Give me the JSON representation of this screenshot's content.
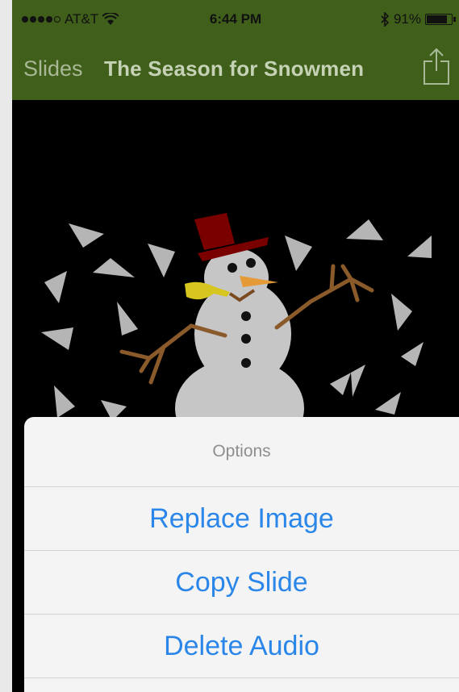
{
  "status": {
    "carrier": "AT&T",
    "time": "6:44 PM",
    "battery_text": "91%",
    "battery_level": 0.91
  },
  "nav": {
    "back_label": "Slides",
    "title": "The Season for Snowmen"
  },
  "sheet": {
    "header": "Options",
    "options": [
      "Replace Image",
      "Copy Slide",
      "Delete Audio"
    ]
  },
  "colors": {
    "nav_background": "#3f5f1b",
    "action_blue": "#2a86e8"
  }
}
